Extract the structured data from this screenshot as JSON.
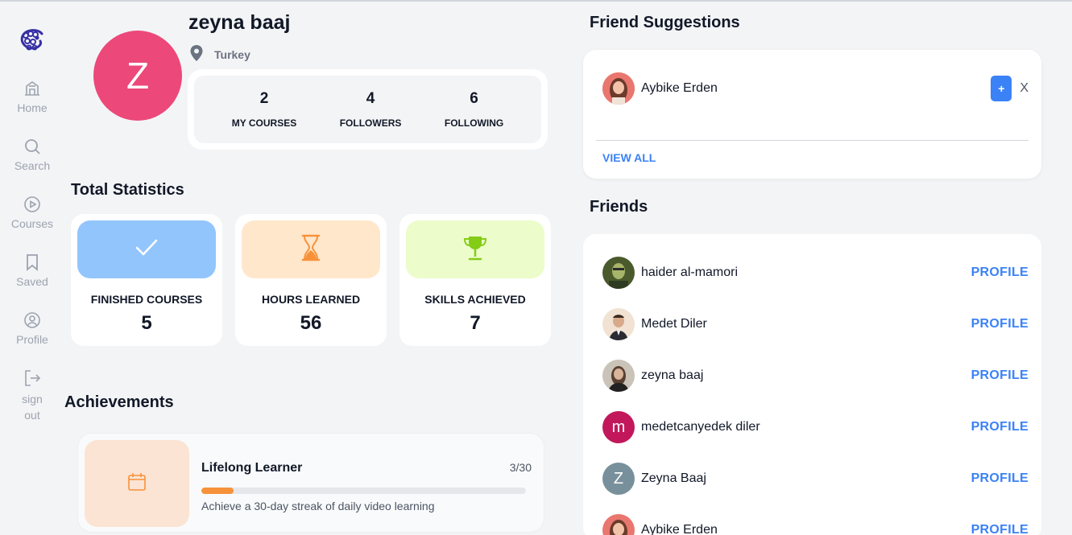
{
  "sidebar": {
    "items": [
      {
        "label": "Home",
        "icon": "home-icon"
      },
      {
        "label": "Search",
        "icon": "search-icon"
      },
      {
        "label": "Courses",
        "icon": "play-circle-icon"
      },
      {
        "label": "Saved",
        "icon": "bookmark-icon"
      },
      {
        "label": "Profile",
        "icon": "user-circle-icon"
      },
      {
        "label": "sign out",
        "icon": "sign-out-icon"
      }
    ]
  },
  "profile": {
    "initial": "Z",
    "name": "zeyna baaj",
    "location": "Turkey",
    "avatar_color": "#ec4879",
    "stats": [
      {
        "value": "2",
        "label": "MY COURSES"
      },
      {
        "value": "4",
        "label": "FOLLOWERS"
      },
      {
        "value": "6",
        "label": "FOLLOWING"
      }
    ]
  },
  "statistics": {
    "title": "Total Statistics",
    "cards": [
      {
        "label": "FINISHED COURSES",
        "value": "5",
        "icon": "check-icon",
        "color": "#93c5fd"
      },
      {
        "label": "HOURS LEARNED",
        "value": "56",
        "icon": "hourglass-icon",
        "color": "#ffe7cc"
      },
      {
        "label": "SKILLS ACHIEVED",
        "value": "7",
        "icon": "trophy-icon",
        "color": "#ecfccb"
      }
    ]
  },
  "achievements": {
    "title": "Achievements",
    "items": [
      {
        "title": "Lifelong Learner",
        "progress": "3/30",
        "progress_fraction": 0.1,
        "description": "Achieve a 30-day streak of daily video learning",
        "icon": "calendar-icon"
      }
    ]
  },
  "suggestions": {
    "title": "Friend Suggestions",
    "people": [
      {
        "name": "Aybike Erden",
        "add_label": "+",
        "dismiss_label": "X"
      }
    ],
    "view_all": "VIEW ALL"
  },
  "friends": {
    "title": "Friends",
    "link_label": "PROFILE",
    "people": [
      {
        "name": "haider al-mamori",
        "avatar": "photo"
      },
      {
        "name": "Medet Diler",
        "avatar": "photo"
      },
      {
        "name": "zeyna baaj",
        "avatar": "photo"
      },
      {
        "name": "medetcanyedek diler",
        "avatar": "m",
        "color": "#c2185b"
      },
      {
        "name": "Zeyna Baaj",
        "avatar": "Z",
        "color": "#78909c"
      },
      {
        "name": "Aybike Erden",
        "avatar": "photo"
      }
    ]
  },
  "colors": {
    "accent": "#3b82f6",
    "progress": "#f7923a"
  }
}
